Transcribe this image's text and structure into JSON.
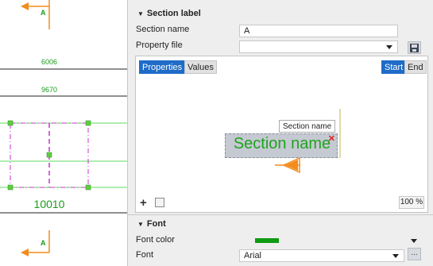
{
  "drawing": {
    "dim_top": "6006",
    "dim_mid": "9670",
    "dim_bottom": "10010",
    "marker_top": "A",
    "marker_bottom": "A",
    "line_color": "#1a9b1a",
    "arrow_color": "#f28c1b",
    "frame_color": "#c833c8"
  },
  "section_label": {
    "title": "Section label",
    "section_name_label": "Section name",
    "section_name_value": "A",
    "property_file_label": "Property file",
    "property_file_value": ""
  },
  "preview": {
    "tab_properties": "Properties",
    "tab_values": "Values",
    "tab_start": "Start",
    "tab_end": "End",
    "tooltip": "Section name",
    "label_text": "Section name",
    "zoom": "100 %",
    "accent": "#1e6cc8"
  },
  "font_section": {
    "title": "Font",
    "font_color_label": "Font color",
    "font_color_value": "#0e9b12",
    "font_label": "Font",
    "font_value": "Arial",
    "more_button": "..."
  }
}
